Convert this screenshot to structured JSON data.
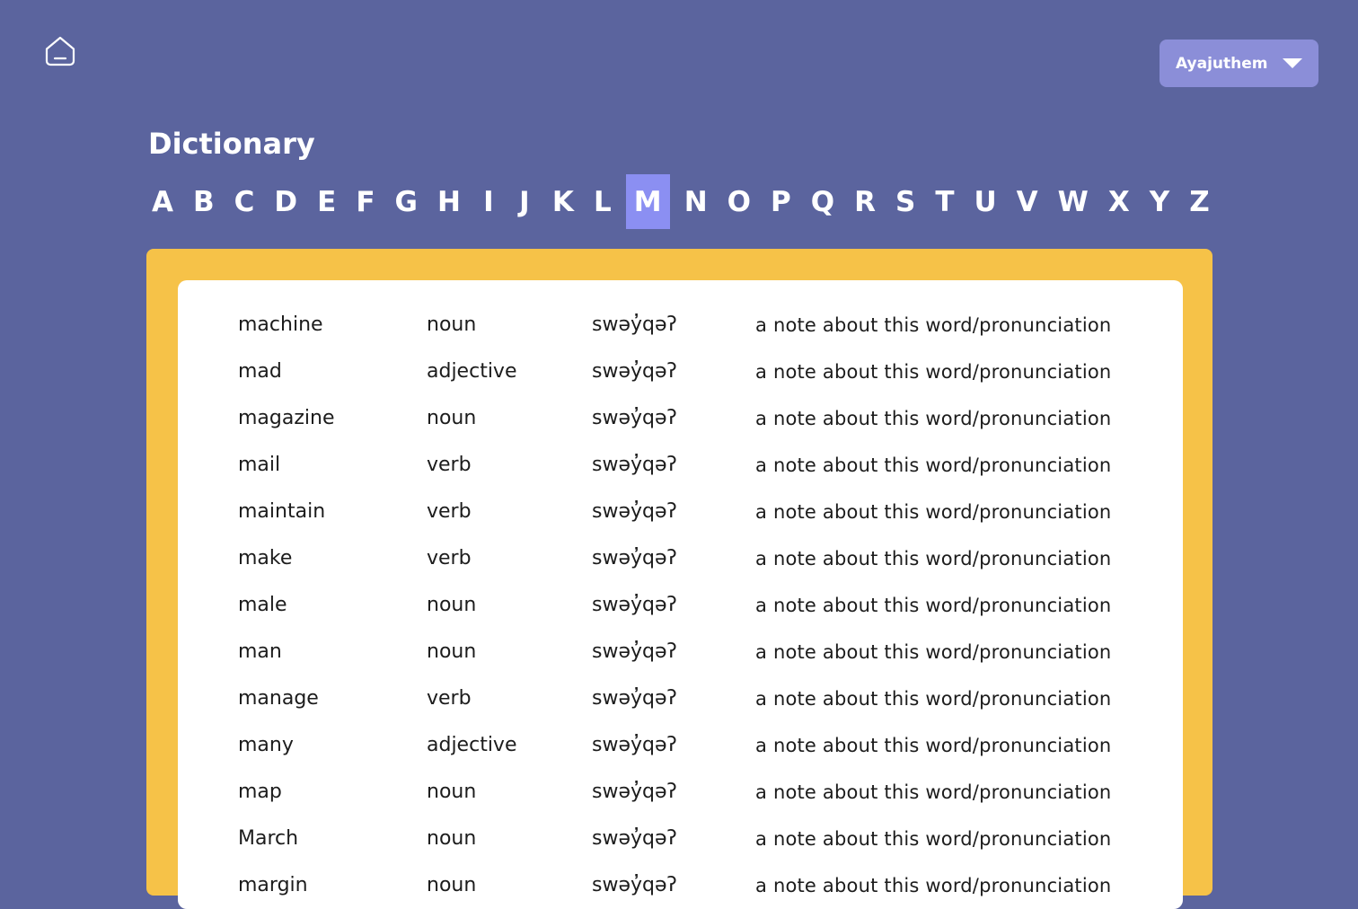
{
  "header": {
    "home_icon": "home-icon",
    "language_selector": {
      "selected": "Ayajuthem",
      "icon": "chevron-down-icon"
    }
  },
  "page": {
    "title": "Dictionary"
  },
  "alphabet": {
    "letters": [
      "A",
      "B",
      "C",
      "D",
      "E",
      "F",
      "G",
      "H",
      "I",
      "J",
      "K",
      "L",
      "M",
      "N",
      "O",
      "P",
      "Q",
      "R",
      "S",
      "T",
      "U",
      "V",
      "W",
      "X",
      "Y",
      "Z"
    ],
    "active": "M"
  },
  "colors": {
    "background": "#5b649e",
    "accent": "#8b8ff2",
    "selector": "#8b8ed8",
    "frame": "#f6c248",
    "card": "#ffffff"
  },
  "dictionary": {
    "entries": [
      {
        "word": "machine",
        "pos": "noun",
        "pronunciation": "swəy̓qəʔ",
        "note": "a note about this word/pronunciation"
      },
      {
        "word": "mad",
        "pos": "adjective",
        "pronunciation": "swəy̓qəʔ",
        "note": "a note about this word/pronunciation"
      },
      {
        "word": "magazine",
        "pos": "noun",
        "pronunciation": "swəy̓qəʔ",
        "note": "a note about this word/pronunciation"
      },
      {
        "word": "mail",
        "pos": "verb",
        "pronunciation": "swəy̓qəʔ",
        "note": "a note about this word/pronunciation"
      },
      {
        "word": "maintain",
        "pos": "verb",
        "pronunciation": "swəy̓qəʔ",
        "note": "a note about this word/pronunciation"
      },
      {
        "word": "make",
        "pos": "verb",
        "pronunciation": "swəy̓qəʔ",
        "note": "a note about this word/pronunciation"
      },
      {
        "word": "male",
        "pos": "noun",
        "pronunciation": "swəy̓qəʔ",
        "note": "a note about this word/pronunciation"
      },
      {
        "word": "man",
        "pos": "noun",
        "pronunciation": "swəy̓qəʔ",
        "note": "a note about this word/pronunciation"
      },
      {
        "word": "manage",
        "pos": "verb",
        "pronunciation": "swəy̓qəʔ",
        "note": "a note about this word/pronunciation"
      },
      {
        "word": "many",
        "pos": "adjective",
        "pronunciation": "swəy̓qəʔ",
        "note": "a note about this word/pronunciation"
      },
      {
        "word": "map",
        "pos": "noun",
        "pronunciation": "swəy̓qəʔ",
        "note": "a note about this word/pronunciation"
      },
      {
        "word": "March",
        "pos": "noun",
        "pronunciation": "swəy̓qəʔ",
        "note": "a note about this word/pronunciation"
      },
      {
        "word": "margin",
        "pos": "noun",
        "pronunciation": "swəy̓qəʔ",
        "note": "a note about this word/pronunciation"
      }
    ]
  }
}
